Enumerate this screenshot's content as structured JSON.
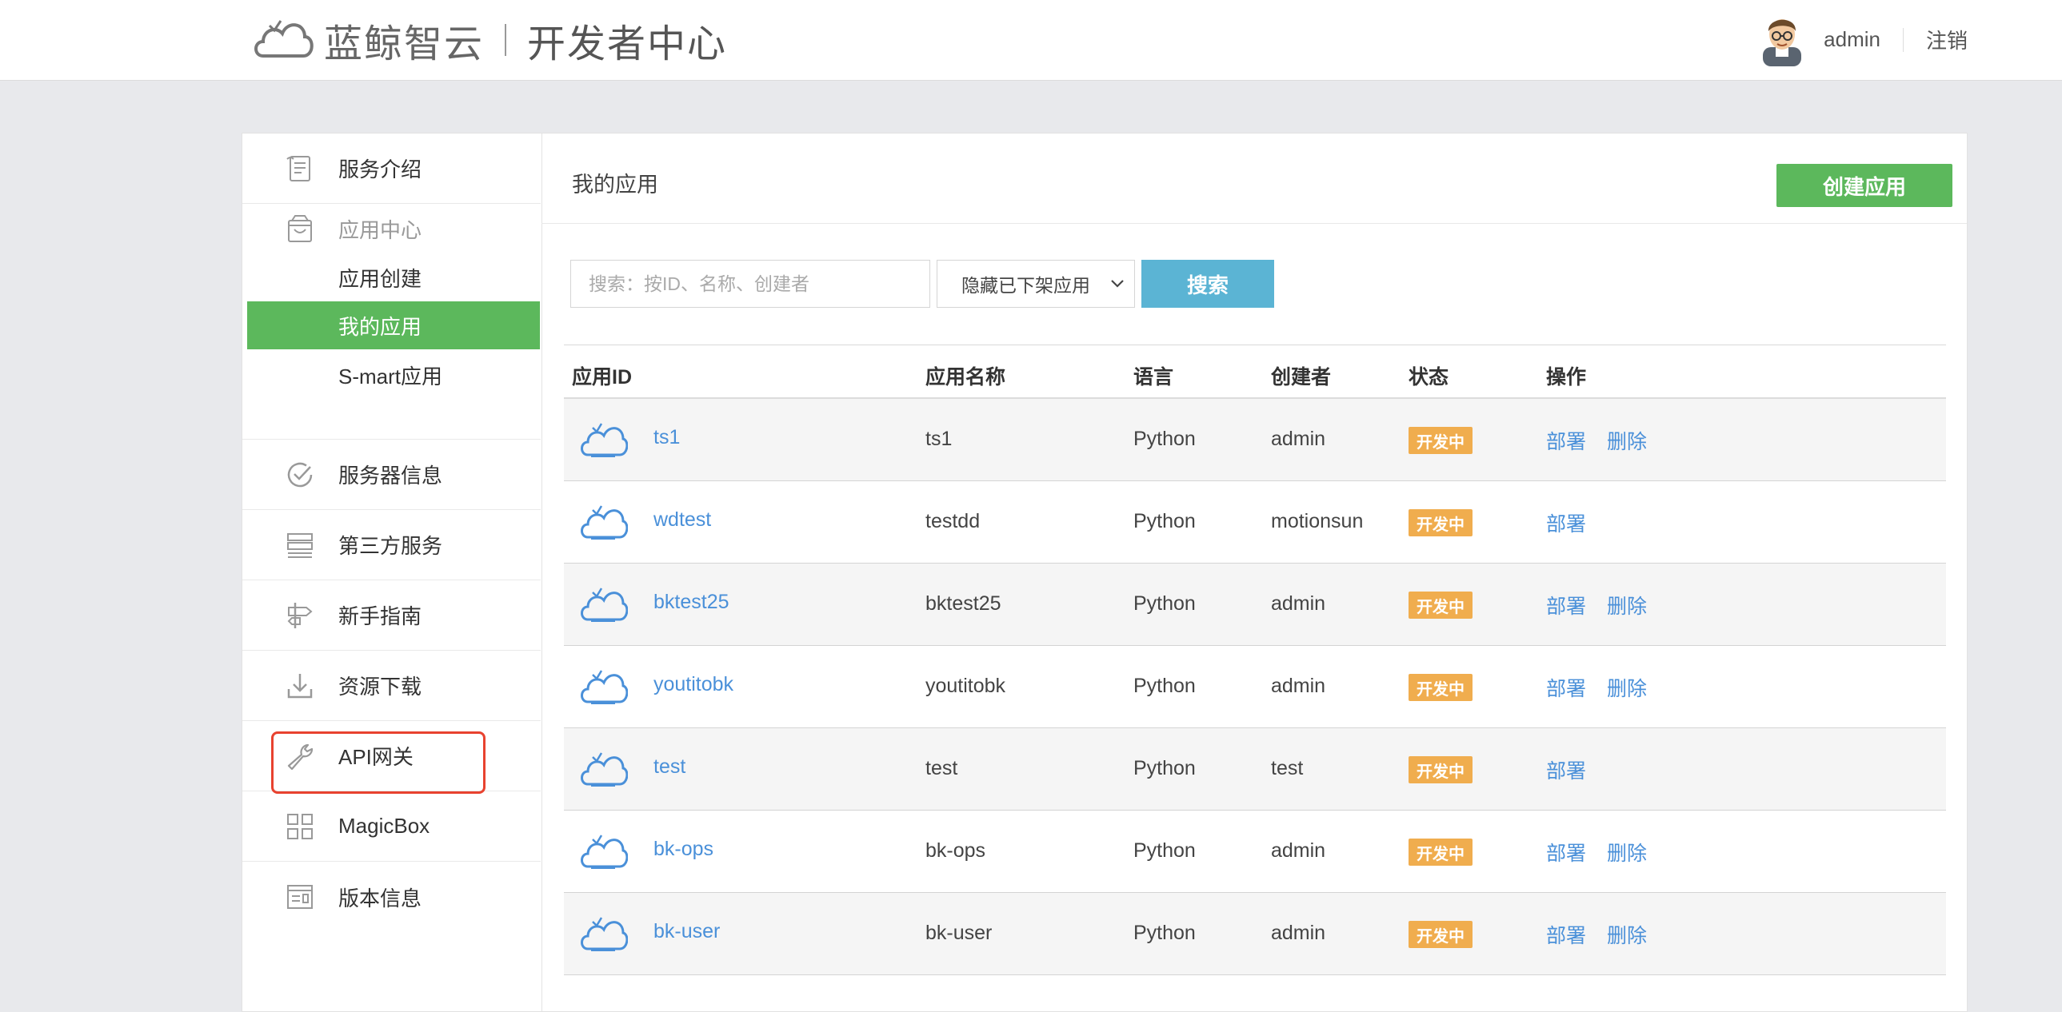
{
  "header": {
    "brand": "蓝鲸智云",
    "subtitle": "开发者中心",
    "username": "admin",
    "logout": "注销"
  },
  "sidebar": {
    "items": [
      {
        "label": "服务介绍",
        "icon": "document-icon"
      },
      {
        "label": "应用中心",
        "icon": "bag-icon"
      },
      {
        "label": "服务器信息",
        "icon": "check-circle-icon"
      },
      {
        "label": "第三方服务",
        "icon": "server-icon"
      },
      {
        "label": "新手指南",
        "icon": "signpost-icon"
      },
      {
        "label": "资源下载",
        "icon": "download-icon"
      },
      {
        "label": "API网关",
        "icon": "wrench-icon"
      },
      {
        "label": "MagicBox",
        "icon": "grid-icon"
      },
      {
        "label": "版本信息",
        "icon": "info-panel-icon"
      }
    ],
    "app_center_sub": [
      {
        "label": "应用创建"
      },
      {
        "label": "我的应用",
        "active": true
      },
      {
        "label": "S-mart应用"
      }
    ]
  },
  "content": {
    "title": "我的应用",
    "create_button": "创建应用",
    "search_placeholder": "搜索：按ID、名称、创建者",
    "filter_selected": "隐藏已下架应用",
    "search_button": "搜索"
  },
  "table": {
    "columns": [
      "应用ID",
      "应用名称",
      "语言",
      "创建者",
      "状态",
      "操作"
    ],
    "rows": [
      {
        "id": "ts1",
        "name": "ts1",
        "lang": "Python",
        "creator": "admin",
        "status": "开发中",
        "deploy": "部署",
        "delete": "删除"
      },
      {
        "id": "wdtest",
        "name": "testdd",
        "lang": "Python",
        "creator": "motionsun",
        "status": "开发中",
        "deploy": "部署",
        "delete": ""
      },
      {
        "id": "bktest25",
        "name": "bktest25",
        "lang": "Python",
        "creator": "admin",
        "status": "开发中",
        "deploy": "部署",
        "delete": "删除"
      },
      {
        "id": "youtitobk",
        "name": "youtitobk",
        "lang": "Python",
        "creator": "admin",
        "status": "开发中",
        "deploy": "部署",
        "delete": "删除"
      },
      {
        "id": "test",
        "name": "test",
        "lang": "Python",
        "creator": "test",
        "status": "开发中",
        "deploy": "部署",
        "delete": ""
      },
      {
        "id": "bk-ops",
        "name": "bk-ops",
        "lang": "Python",
        "creator": "admin",
        "status": "开发中",
        "deploy": "部署",
        "delete": "删除"
      },
      {
        "id": "bk-user",
        "name": "bk-user",
        "lang": "Python",
        "creator": "admin",
        "status": "开发中",
        "deploy": "部署",
        "delete": "删除"
      }
    ]
  },
  "colors": {
    "primary_green": "#5cb85c",
    "search_blue": "#5bb4d4",
    "status_orange": "#f0ad4e",
    "link_blue": "#4a90d9",
    "highlight_red": "#e8422f"
  }
}
